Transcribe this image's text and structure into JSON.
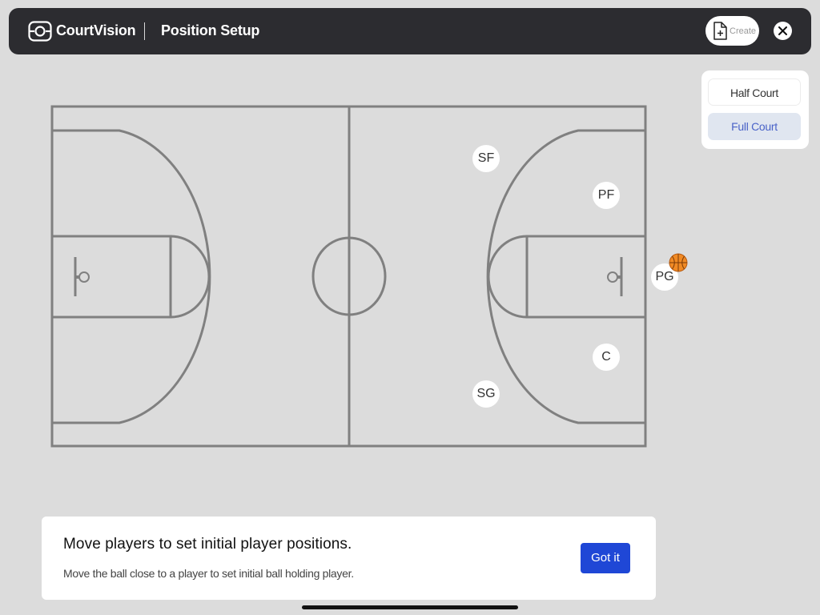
{
  "header": {
    "brand": "CourtVision",
    "title": "Position Setup",
    "create_label": "Create"
  },
  "court_toggle": {
    "options": [
      "Half Court",
      "Full Court"
    ],
    "selected": "Full Court"
  },
  "players": [
    {
      "label": "SF"
    },
    {
      "label": "PF"
    },
    {
      "label": "PG"
    },
    {
      "label": "C"
    },
    {
      "label": "SG"
    }
  ],
  "ball_holder": "PG",
  "hint": {
    "heading": "Move players to set initial player positions.",
    "subtext": "Move the ball close to a player to set initial ball holding player.",
    "button_label": "Got it"
  },
  "colors": {
    "topbar": "#2c2c30",
    "background": "#dcdcdc",
    "court_lines": "#808080",
    "accent": "#1f47d6",
    "toggle_selected_bg": "#e0e6f0",
    "toggle_selected_text": "#4a63c8"
  }
}
